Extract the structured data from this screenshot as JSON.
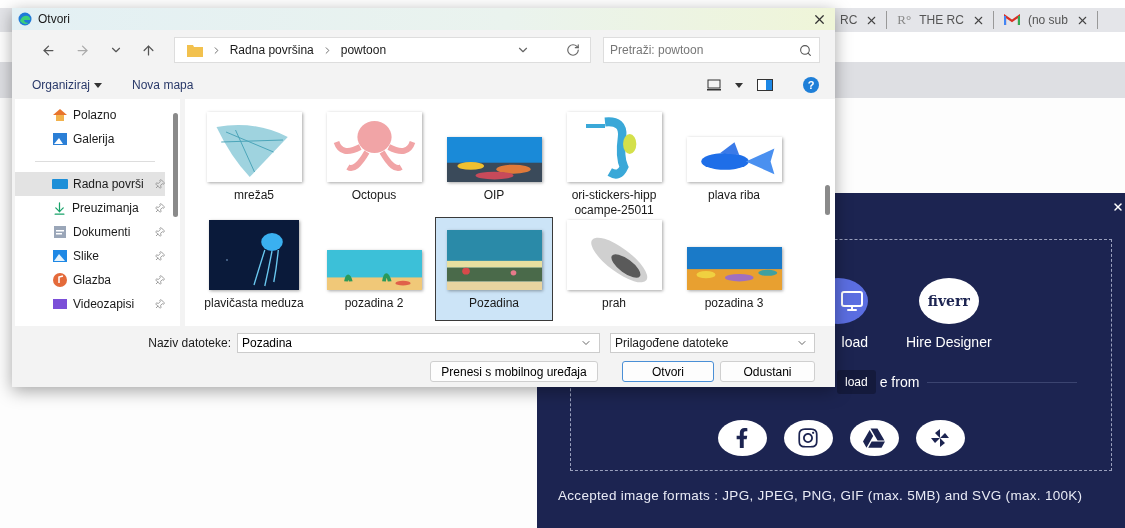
{
  "browser": {
    "tabs": [
      {
        "title": "RC",
        "kind": "plain"
      },
      {
        "title": "THE RC",
        "kind": "letter",
        "icon_text": "R°"
      },
      {
        "title": "(no sub",
        "kind": "mail"
      }
    ]
  },
  "modal": {
    "options": [
      {
        "label": "load",
        "kind": "upload"
      },
      {
        "label": "Hire Designer",
        "kind": "fiverr",
        "logo": "fiverr"
      }
    ],
    "tooltip": "load",
    "source_label": "e from",
    "sources": [
      {
        "kind": "facebook"
      },
      {
        "kind": "instagram"
      },
      {
        "kind": "drive"
      },
      {
        "kind": "photos"
      }
    ],
    "formats": "Accepted image formats : JPG, JPEG, PNG, GIF (max. 5MB) and SVG (max. 100K)"
  },
  "dialog": {
    "title": "Otvori",
    "breadcrumb": [
      "Radna površina",
      "powtoon"
    ],
    "search": {
      "placeholder": "Pretraži: powtoon"
    },
    "toolbar": [
      "Organiziraj",
      "Nova mapa"
    ],
    "help": "?",
    "sidebar": [
      {
        "kind": "home",
        "label": "Polazno",
        "pinned": false,
        "selected": false
      },
      {
        "kind": "gallery",
        "label": "Galerija",
        "pinned": false,
        "selected": false
      },
      {
        "kind": "divider"
      },
      {
        "kind": "desktop",
        "label": "Radna površi",
        "pinned": true,
        "selected": true
      },
      {
        "kind": "download",
        "label": "Preuzimanja",
        "pinned": true,
        "selected": false
      },
      {
        "kind": "documents",
        "label": "Dokumenti",
        "pinned": true,
        "selected": false
      },
      {
        "kind": "pictures",
        "label": "Slike",
        "pinned": true,
        "selected": false
      },
      {
        "kind": "music",
        "label": "Glazba",
        "pinned": true,
        "selected": false
      },
      {
        "kind": "video",
        "label": "Videozapisi",
        "pinned": true,
        "selected": false
      }
    ],
    "files": [
      {
        "label": "mreža5",
        "selected": false
      },
      {
        "label": "Octopus",
        "selected": false
      },
      {
        "label": "OIP",
        "selected": false
      },
      {
        "label": "ori-stickers-hipp ocampe-25011",
        "selected": false
      },
      {
        "label": "plava riba",
        "selected": false
      },
      {
        "label": "plavičasta meduza",
        "selected": false
      },
      {
        "label": "pozadina 2",
        "selected": false
      },
      {
        "label": "Pozadina",
        "selected": true
      },
      {
        "label": "prah",
        "selected": false
      },
      {
        "label": "pozadina 3",
        "selected": false
      }
    ],
    "filename_label": "Naziv datoteke:",
    "filename": "Pozadina",
    "filter": "Prilagođene datoteke",
    "buttons": [
      {
        "label": "Prenesi s mobilnog uređaja",
        "default": false
      },
      {
        "label": "Otvori",
        "default": true
      },
      {
        "label": "Odustani",
        "default": false
      }
    ]
  }
}
